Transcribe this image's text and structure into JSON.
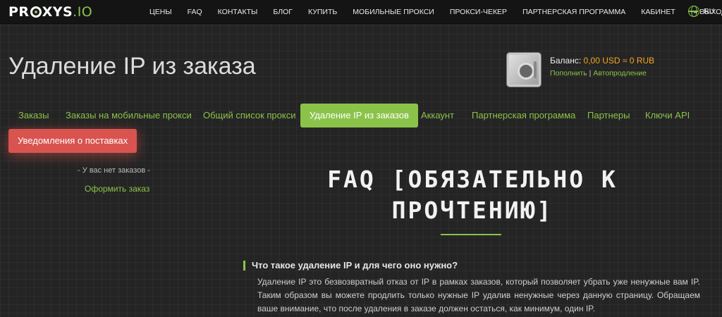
{
  "logo": {
    "pre": "PR",
    "post": "XYS",
    "io": ".IO"
  },
  "nav": {
    "items": [
      "ЦЕНЫ",
      "FAQ",
      "КОНТАКТЫ",
      "БЛОГ",
      "КУПИТЬ",
      "МОБИЛЬНЫЕ ПРОКСИ",
      "ПРОКСИ-ЧЕКЕР",
      "ПАРТНЕРСКАЯ ПРОГРАММА",
      "КАБИНЕТ"
    ],
    "logout": "ВЫХОД",
    "lang": "RU"
  },
  "page_title": "Удаление IP из заказа",
  "balance": {
    "label": "Баланс: ",
    "amount": "0,00 USD ≈ 0 RUB",
    "topup": "Пополнить",
    "separator": " | ",
    "autorenew": "Автопродление"
  },
  "tabs": [
    "Заказы",
    "Заказы на мобильные прокси",
    "Общий список прокси",
    "Удаление IP из заказов",
    "Аккаунт",
    "Партнерская программа",
    "Партнеры",
    "Ключи API",
    "Уведомления о поставках"
  ],
  "sidebar": {
    "no_orders": "- У вас нет заказов -",
    "order_link": "Оформить заказ"
  },
  "faq": {
    "title_line1": "FAQ [ОБЯЗАТЕЛЬНО К",
    "title_line2": "ПРОЧТЕНИЮ]",
    "question": "Что такое удаление IP и для чего оно нужно?",
    "answer": "Удаление IP это безвозвратный отказ от IP в рамках заказов, который позволяет убрать уже ненужные вам IP. Таким образом вы можете продлить только нужные IP удалив ненужные через данную страницу. Обращаем ваше внимание, что после удаления в заказе должен остаться, как минимум, один IP."
  },
  "colors": {
    "accent": "#8bc34a",
    "danger": "#d9534f",
    "amount": "#f5a623"
  }
}
